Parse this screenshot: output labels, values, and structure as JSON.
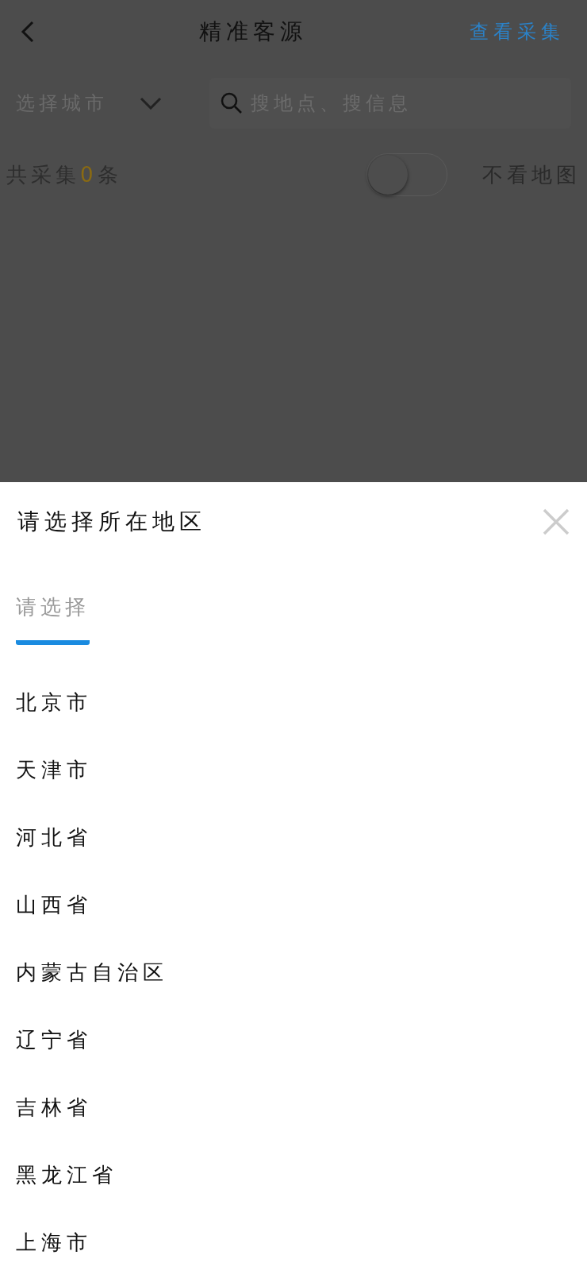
{
  "header": {
    "title": "精准客源",
    "action": "查看采集"
  },
  "filter": {
    "city": "选择城市",
    "search_placeholder": "搜地点、搜信息"
  },
  "summary": {
    "prefix": "共采集",
    "count": "0",
    "suffix": "条",
    "map_toggle": {
      "on": false,
      "label": "不看地图"
    }
  },
  "sheet": {
    "title": "请选择所在地区",
    "tabs": [
      {
        "label": "请选择",
        "selected": true
      }
    ],
    "items": [
      "北京市",
      "天津市",
      "河北省",
      "山西省",
      "内蒙古自治区",
      "辽宁省",
      "吉林省",
      "黑龙江省",
      "上海市"
    ]
  }
}
